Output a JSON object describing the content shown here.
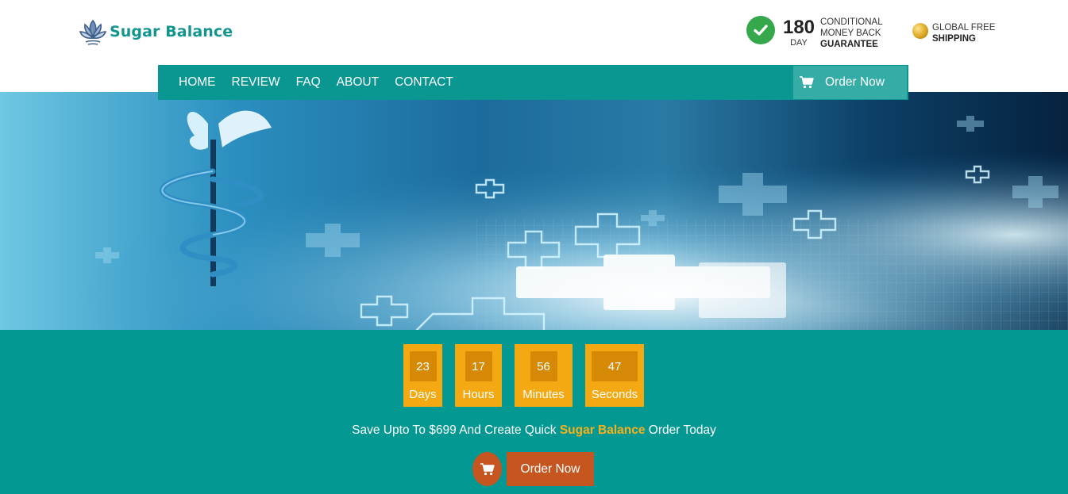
{
  "brand": {
    "name": "Sugar Balance",
    "logo_icon": "lotus-logo-icon"
  },
  "guarantee": {
    "icon": "check-circle-icon",
    "number": "180",
    "unit": "DAY",
    "line1": "CONDITIONAL",
    "line2": "MONEY BACK",
    "line3": "GUARANTEE"
  },
  "shipping": {
    "icon": "globe-icon",
    "line1": "GLOBAL FREE",
    "line2": "SHIPPING"
  },
  "nav": {
    "items": [
      "HOME",
      "REVIEW",
      "FAQ",
      "ABOUT",
      "CONTACT"
    ],
    "order_label": "Order Now",
    "order_icon": "cart-icon"
  },
  "countdown": {
    "days": {
      "value": "23",
      "label": "Days"
    },
    "hours": {
      "value": "17",
      "label": "Hours"
    },
    "minutes": {
      "value": "56",
      "label": "Minutes"
    },
    "seconds": {
      "value": "47",
      "label": "Seconds"
    }
  },
  "promo": {
    "prefix": "Save Upto To $699 And Create Quick ",
    "highlight": "Sugar Balance",
    "suffix": " Order Today",
    "cta_label": "Order Now",
    "cta_icon": "cart-icon"
  },
  "colors": {
    "brand_teal": "#0a9791",
    "accent_orange": "#f4a812",
    "cta_orange": "#c5561f",
    "highlight_yellow": "#f6b21d"
  }
}
